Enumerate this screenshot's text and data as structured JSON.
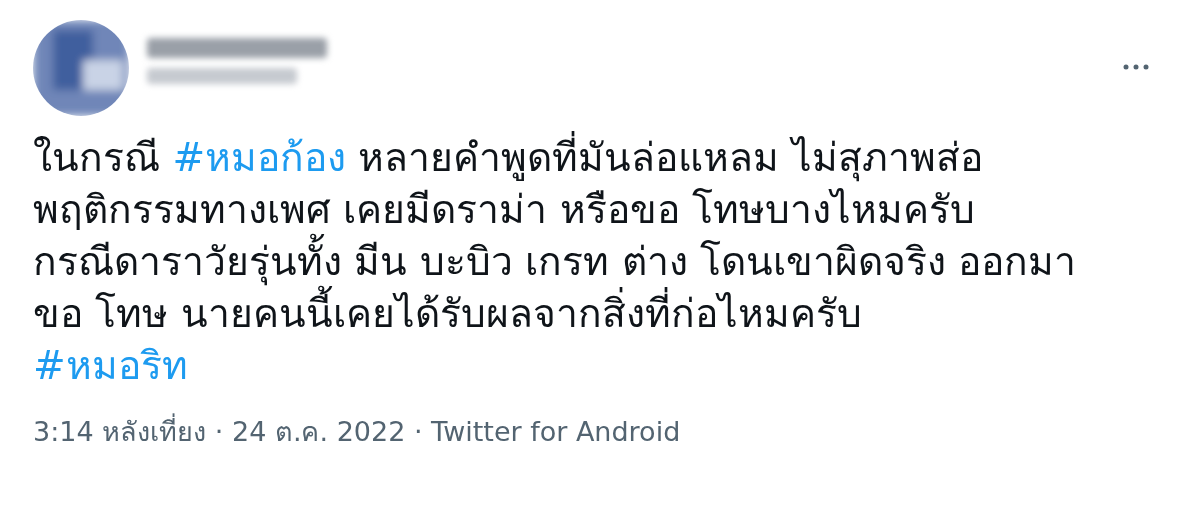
{
  "tweet": {
    "body": [
      [
        {
          "kind": "text",
          "text": "ในกรณี "
        },
        {
          "kind": "hashtag",
          "text": "#หมอก้อง"
        },
        {
          "kind": "text",
          "text": " หลายคำพูดที่มันล่อแหลม ไม่สุภาพส่อ"
        }
      ],
      [
        {
          "kind": "text",
          "text": "พฤติกรรมทางเพศ เคยมีดราม่า หรือขอ โทษบางไหมครับ"
        }
      ],
      [
        {
          "kind": "text",
          "text": "กรณีดาราวัยรุ่นทั้ง มีน บะบิว เกรท ต่าง โดนเขาผิดจริง ออกมา"
        }
      ],
      [
        {
          "kind": "text",
          "text": "ขอ โทษ นายคนนี้เคยได้รับผลจากสิ่งที่ก่อไหมครับ"
        }
      ],
      [
        {
          "kind": "hashtag",
          "text": "#หมอริท"
        }
      ]
    ],
    "meta": "3:14 หลังเที่ยง · 24 ต.ค. 2022 · Twitter for Android"
  }
}
